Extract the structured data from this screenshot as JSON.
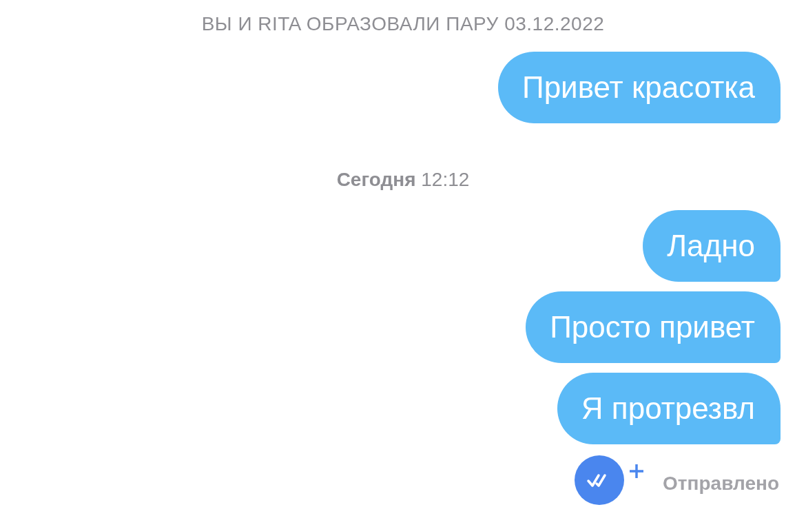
{
  "match_banner": "ВЫ И RITA ОБРАЗОВАЛИ ПАРУ 03.12.2022",
  "groups": [
    {
      "messages": [
        {
          "kind": "outgoing",
          "text": "Привет красотка"
        }
      ]
    },
    {
      "time": "**Сегодня** 12:12",
      "messages": [
        {
          "kind": "outgoing",
          "text": "Ладно"
        },
        {
          "kind": "outgoing",
          "text": "Просто привет"
        },
        {
          "kind": "outgoing",
          "text": "Я протрезвл"
        }
      ]
    }
  ],
  "status": {
    "label": "Отправлено"
  }
}
